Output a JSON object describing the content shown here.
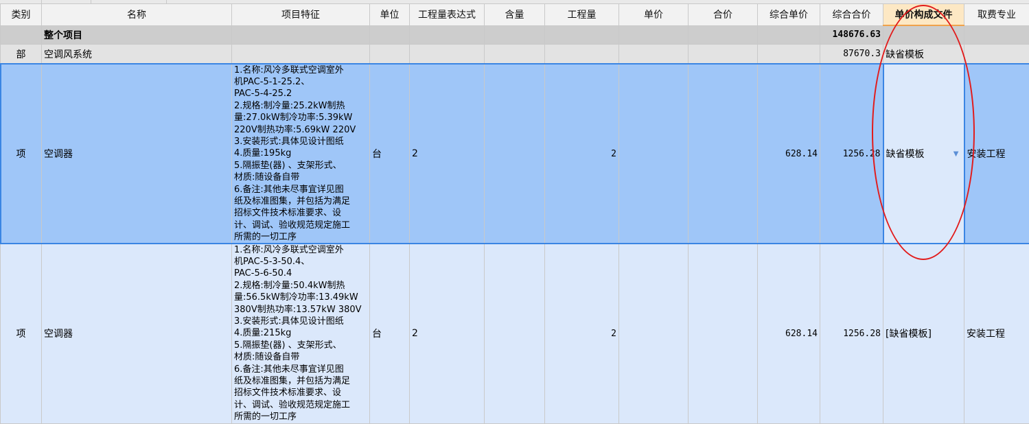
{
  "columns": [
    "类别",
    "名称",
    "项目特征",
    "单位",
    "工程量表达式",
    "含量",
    "工程量",
    "单价",
    "合价",
    "综合单价",
    "综合合价",
    "单价构成文件",
    "取费专业"
  ],
  "total_row": {
    "name": "整个项目",
    "total": "148676.63"
  },
  "section_row": {
    "type": "部",
    "name": "空调风系统",
    "total": "87670.3",
    "template": "缺省模板"
  },
  "items": [
    {
      "type": "项",
      "name": "空调器",
      "desc": [
        "1.名称:风冷多联式空调室外",
        "机PAC-5-1-25.2、",
        "PAC-5-4-25.2",
        "2.规格:制冷量:25.2kW制热",
        "量:27.0kW制冷功率:5.39kW",
        "220V制热功率:5.69kW 220V",
        "3.安装形式:具体见设计图纸",
        "4.质量:195kg",
        "5.隔振垫(器) 、支架形式、",
        "材质:随设备自带",
        "6.备注:其他未尽事宜详见图",
        "纸及标准图集，并包括为满足",
        "招标文件技术标准要求、设",
        "计、调试、验收规范规定施工",
        "所需的一切工序"
      ],
      "unit": "台",
      "expr": "2",
      "qty": "2",
      "unit_price": "628.14",
      "total": "1256.28",
      "template": "缺省模板",
      "specialty": "安装工程"
    },
    {
      "type": "项",
      "name": "空调器",
      "desc": [
        "1.名称:风冷多联式空调室外",
        "机PAC-5-3-50.4、",
        "PAC-5-6-50.4",
        "2.规格:制冷量:50.4kW制热",
        "量:56.5kW制冷功率:13.49kW",
        "380V制热功率:13.57kW 380V",
        "3.安装形式:具体见设计图纸",
        "4.质量:215kg",
        "5.隔振垫(器) 、支架形式、",
        "材质:随设备自带",
        "6.备注:其他未尽事宜详见图",
        "纸及标准图集，并包括为满足",
        "招标文件技术标准要求、设",
        "计、调试、验收规范规定施工",
        "所需的一切工序"
      ],
      "unit": "台",
      "expr": "2",
      "qty": "2",
      "unit_price": "628.14",
      "total": "1256.28",
      "template": "[缺省模板]",
      "specialty": "安装工程"
    }
  ],
  "icons": {
    "dropdown": "chevron-down-icon"
  },
  "colors": {
    "selected_row": "#9fc6f8",
    "item_row": "#dbe8fb",
    "annotation": "#e21b1b",
    "active_header": "#fde8c4"
  }
}
